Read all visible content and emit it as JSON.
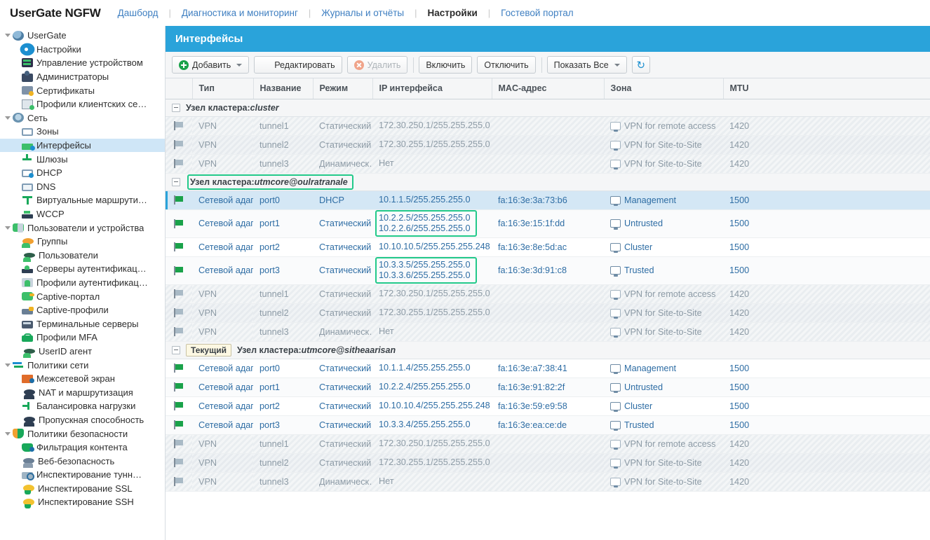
{
  "header": {
    "brand": "UserGate NGFW",
    "nav": [
      {
        "label": "Дашборд",
        "active": false
      },
      {
        "label": "Диагностика и мониторинг",
        "active": false
      },
      {
        "label": "Журналы и отчёты",
        "active": false
      },
      {
        "label": "Настройки",
        "active": true
      },
      {
        "label": "Гостевой портал",
        "active": false
      }
    ]
  },
  "sidebar": {
    "items": [
      {
        "label": "UserGate",
        "level": 1,
        "icon": "usergate-globe-icon",
        "expanded": true,
        "selected": false
      },
      {
        "label": "Настройки",
        "level": 2,
        "icon": "gear-icon",
        "selected": false
      },
      {
        "label": "Управление устройством",
        "level": 2,
        "icon": "device-management-icon",
        "selected": false
      },
      {
        "label": "Администраторы",
        "level": 2,
        "icon": "administrators-icon",
        "selected": false
      },
      {
        "label": "Сертификаты",
        "level": 2,
        "icon": "certificate-icon",
        "selected": false
      },
      {
        "label": "Профили клиентских се…",
        "level": 2,
        "icon": "client-profiles-icon",
        "selected": false
      },
      {
        "label": "Сеть",
        "level": 1,
        "icon": "network-globe-icon",
        "expanded": true,
        "selected": false
      },
      {
        "label": "Зоны",
        "level": 2,
        "icon": "zone-icon",
        "selected": false
      },
      {
        "label": "Интерфейсы",
        "level": 2,
        "icon": "interfaces-icon",
        "selected": true
      },
      {
        "label": "Шлюзы",
        "level": 2,
        "icon": "gateway-icon",
        "selected": false
      },
      {
        "label": "DHCP",
        "level": 2,
        "icon": "dhcp-icon",
        "selected": false
      },
      {
        "label": "DNS",
        "level": 2,
        "icon": "dns-icon",
        "selected": false
      },
      {
        "label": "Виртуальные маршрути…",
        "level": 2,
        "icon": "virtual-router-icon",
        "selected": false
      },
      {
        "label": "WCCP",
        "level": 2,
        "icon": "wccp-icon",
        "selected": false
      },
      {
        "label": "Пользователи и устройства",
        "level": 1,
        "icon": "users-devices-icon",
        "expanded": true,
        "selected": false
      },
      {
        "label": "Группы",
        "level": 2,
        "icon": "groups-icon",
        "selected": false
      },
      {
        "label": "Пользователи",
        "level": 2,
        "icon": "users-icon",
        "selected": false
      },
      {
        "label": "Серверы аутентификац…",
        "level": 2,
        "icon": "auth-servers-icon",
        "selected": false
      },
      {
        "label": "Профили аутентификац…",
        "level": 2,
        "icon": "auth-profiles-icon",
        "selected": false
      },
      {
        "label": "Captive-портал",
        "level": 2,
        "icon": "captive-portal-icon",
        "selected": false
      },
      {
        "label": "Captive-профили",
        "level": 2,
        "icon": "captive-profiles-icon",
        "selected": false
      },
      {
        "label": "Терминальные серверы",
        "level": 2,
        "icon": "terminal-servers-icon",
        "selected": false
      },
      {
        "label": "Профили MFA",
        "level": 2,
        "icon": "mfa-lock-icon",
        "selected": false
      },
      {
        "label": "UserID агент",
        "level": 2,
        "icon": "userid-agent-icon",
        "selected": false
      },
      {
        "label": "Политики сети",
        "level": 1,
        "icon": "network-policies-icon",
        "expanded": true,
        "selected": false
      },
      {
        "label": "Межсетевой экран",
        "level": 2,
        "icon": "firewall-icon",
        "selected": false
      },
      {
        "label": "NAT и маршрутизация",
        "level": 2,
        "icon": "nat-routing-icon",
        "selected": false
      },
      {
        "label": "Балансировка нагрузки",
        "level": 2,
        "icon": "load-balancing-icon",
        "selected": false
      },
      {
        "label": "Пропускная способность",
        "level": 2,
        "icon": "bandwidth-icon",
        "selected": false
      },
      {
        "label": "Политики безопасности",
        "level": 1,
        "icon": "security-shield-icon",
        "expanded": true,
        "selected": false
      },
      {
        "label": "Фильтрация контента",
        "level": 2,
        "icon": "content-filter-icon",
        "selected": false
      },
      {
        "label": "Веб-безопасность",
        "level": 2,
        "icon": "web-security-icon",
        "selected": false
      },
      {
        "label": "Инспектирование тунн…",
        "level": 2,
        "icon": "tunnel-inspection-icon",
        "selected": false
      },
      {
        "label": "Инспектирование SSL",
        "level": 2,
        "icon": "ssl-inspection-icon",
        "selected": false
      },
      {
        "label": "Инспектирование SSH",
        "level": 2,
        "icon": "ssh-inspection-icon",
        "selected": false
      }
    ]
  },
  "panel": {
    "title": "Интерфейсы"
  },
  "toolbar": {
    "add": "Добавить",
    "edit": "Редактировать",
    "delete": "Удалить",
    "enable": "Включить",
    "disable": "Отключить",
    "show_all": "Показать Все",
    "refresh_icon": "refresh-icon"
  },
  "table": {
    "columns": [
      "Тип",
      "Название",
      "Режим",
      "IP интерфейса",
      "MAC-адрес",
      "Зона",
      "MTU"
    ],
    "groups": [
      {
        "label_prefix": "Узел кластера:",
        "node": "cluster",
        "current": false,
        "highlighted": false,
        "rows": [
          {
            "status": "off",
            "type": "VPN",
            "name": "tunnel1",
            "mode": "Статический",
            "ip": [
              "172.30.250.1/255.255.255.0"
            ],
            "mac": "",
            "zone": "VPN for remote access",
            "mtu": "1420",
            "disabled": true,
            "selected": false
          },
          {
            "status": "off",
            "type": "VPN",
            "name": "tunnel2",
            "mode": "Статический",
            "ip": [
              "172.30.255.1/255.255.255.0"
            ],
            "mac": "",
            "zone": "VPN for Site-to-Site",
            "mtu": "1420",
            "disabled": true,
            "selected": false
          },
          {
            "status": "off",
            "type": "VPN",
            "name": "tunnel3",
            "mode": "Динамическ…",
            "ip": [
              "Нет"
            ],
            "mac": "",
            "zone": "VPN for Site-to-Site",
            "mtu": "1420",
            "disabled": true,
            "selected": false
          }
        ]
      },
      {
        "label_prefix": "Узел кластера:",
        "node": "utmcore@oulratranale",
        "current": false,
        "highlighted": true,
        "rows": [
          {
            "status": "on",
            "type": "Сетевой адаптер",
            "name": "port0",
            "mode": "DHCP",
            "ip": [
              "10.1.1.5/255.255.255.0"
            ],
            "mac": "fa:16:3e:3a:73:b6",
            "zone": "Management",
            "mtu": "1500",
            "disabled": false,
            "selected": true
          },
          {
            "status": "on",
            "type": "Сетевой адаптер",
            "name": "port1",
            "mode": "Статический",
            "ip": [
              "10.2.2.5/255.255.255.0",
              "10.2.2.6/255.255.255.0"
            ],
            "mac": "fa:16:3e:15:1f:dd",
            "zone": "Untrusted",
            "mtu": "1500",
            "disabled": false,
            "selected": false,
            "ip_highlighted": true
          },
          {
            "status": "on",
            "type": "Сетевой адаптер",
            "name": "port2",
            "mode": "Статический",
            "ip": [
              "10.10.10.5/255.255.255.248"
            ],
            "mac": "fa:16:3e:8e:5d:ac",
            "zone": "Cluster",
            "mtu": "1500",
            "disabled": false,
            "selected": false
          },
          {
            "status": "on",
            "type": "Сетевой адаптер",
            "name": "port3",
            "mode": "Статический",
            "ip": [
              "10.3.3.5/255.255.255.0",
              "10.3.3.6/255.255.255.0"
            ],
            "mac": "fa:16:3e:3d:91:c8",
            "zone": "Trusted",
            "mtu": "1500",
            "disabled": false,
            "selected": false,
            "ip_highlighted": true
          },
          {
            "status": "off",
            "type": "VPN",
            "name": "tunnel1",
            "mode": "Статический",
            "ip": [
              "172.30.250.1/255.255.255.0"
            ],
            "mac": "",
            "zone": "VPN for remote access",
            "mtu": "1420",
            "disabled": true,
            "selected": false
          },
          {
            "status": "off",
            "type": "VPN",
            "name": "tunnel2",
            "mode": "Статический",
            "ip": [
              "172.30.255.1/255.255.255.0"
            ],
            "mac": "",
            "zone": "VPN for Site-to-Site",
            "mtu": "1420",
            "disabled": true,
            "selected": false
          },
          {
            "status": "off",
            "type": "VPN",
            "name": "tunnel3",
            "mode": "Динамическ…",
            "ip": [
              "Нет"
            ],
            "mac": "",
            "zone": "VPN for Site-to-Site",
            "mtu": "1420",
            "disabled": true,
            "selected": false
          }
        ]
      },
      {
        "label_prefix": "Узел кластера:",
        "node": "utmcore@sitheaarisan",
        "current": true,
        "current_badge": "Текущий",
        "highlighted": false,
        "rows": [
          {
            "status": "on",
            "type": "Сетевой адаптер",
            "name": "port0",
            "mode": "Статический",
            "ip": [
              "10.1.1.4/255.255.255.0"
            ],
            "mac": "fa:16:3e:a7:38:41",
            "zone": "Management",
            "mtu": "1500",
            "disabled": false,
            "selected": false
          },
          {
            "status": "on",
            "type": "Сетевой адаптер",
            "name": "port1",
            "mode": "Статический",
            "ip": [
              "10.2.2.4/255.255.255.0"
            ],
            "mac": "fa:16:3e:91:82:2f",
            "zone": "Untrusted",
            "mtu": "1500",
            "disabled": false,
            "selected": false
          },
          {
            "status": "on",
            "type": "Сетевой адаптер",
            "name": "port2",
            "mode": "Статический",
            "ip": [
              "10.10.10.4/255.255.255.248"
            ],
            "mac": "fa:16:3e:59:e9:58",
            "zone": "Cluster",
            "mtu": "1500",
            "disabled": false,
            "selected": false
          },
          {
            "status": "on",
            "type": "Сетевой адаптер",
            "name": "port3",
            "mode": "Статический",
            "ip": [
              "10.3.3.4/255.255.255.0"
            ],
            "mac": "fa:16:3e:ea:ce:de",
            "zone": "Trusted",
            "mtu": "1500",
            "disabled": false,
            "selected": false
          },
          {
            "status": "off",
            "type": "VPN",
            "name": "tunnel1",
            "mode": "Статический",
            "ip": [
              "172.30.250.1/255.255.255.0"
            ],
            "mac": "",
            "zone": "VPN for remote access",
            "mtu": "1420",
            "disabled": true,
            "selected": false
          },
          {
            "status": "off",
            "type": "VPN",
            "name": "tunnel2",
            "mode": "Статический",
            "ip": [
              "172.30.255.1/255.255.255.0"
            ],
            "mac": "",
            "zone": "VPN for Site-to-Site",
            "mtu": "1420",
            "disabled": true,
            "selected": false
          },
          {
            "status": "off",
            "type": "VPN",
            "name": "tunnel3",
            "mode": "Динамическ…",
            "ip": [
              "Нет"
            ],
            "mac": "",
            "zone": "VPN for Site-to-Site",
            "mtu": "1420",
            "disabled": true,
            "selected": false
          }
        ]
      }
    ]
  },
  "colors": {
    "accent": "#2aa3da",
    "link": "#2e6da4",
    "highlight_box": "#22c98a",
    "selected_row": "#d4e7f5"
  }
}
